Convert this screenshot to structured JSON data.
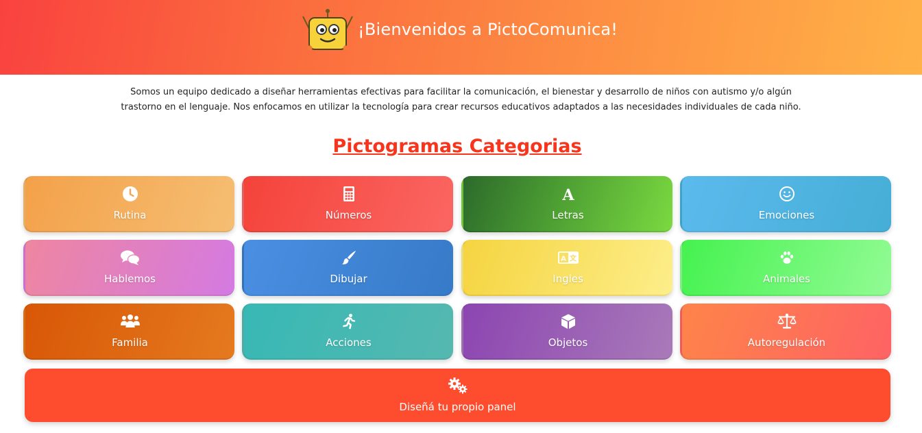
{
  "header": {
    "title": "¡Bienvenidos a PictoComunica!",
    "logo_icon": "robot-logo-icon",
    "gradient": [
      "#f9423f",
      "#ffb247"
    ]
  },
  "intro": {
    "text": "Somos un equipo dedicado a diseñar herramientas efectivas para facilitar la comunicación, el bienestar y desarrollo de niños con autismo y/o algún trastorno en el lenguaje. Nos enfocamos en utilizar la tecnología para crear recursos educativos adaptados a las necesidades individuales de cada niño."
  },
  "section": {
    "title": "Pictogramas Categorias",
    "color": "#f7351c"
  },
  "categories": [
    {
      "label": "Rutina",
      "icon": "clock-icon"
    },
    {
      "label": "Números",
      "icon": "calculator-icon"
    },
    {
      "label": "Letras",
      "icon": "letter-a-icon"
    },
    {
      "label": "Emociones",
      "icon": "smile-icon"
    },
    {
      "label": "Hablemos",
      "icon": "chat-bubbles-icon"
    },
    {
      "label": "Dibujar",
      "icon": "paintbrush-icon"
    },
    {
      "label": "Ingles",
      "icon": "language-icon"
    },
    {
      "label": "Animales",
      "icon": "paw-icon"
    },
    {
      "label": "Familia",
      "icon": "users-icon"
    },
    {
      "label": "Acciones",
      "icon": "running-person-icon"
    },
    {
      "label": "Objetos",
      "icon": "cube-icon"
    },
    {
      "label": "Autoregulación",
      "icon": "balance-scale-icon"
    }
  ],
  "design_panel": {
    "label": "Diseñá tu propio panel",
    "icon": "gears-icon",
    "color": "#fe4d2e"
  }
}
